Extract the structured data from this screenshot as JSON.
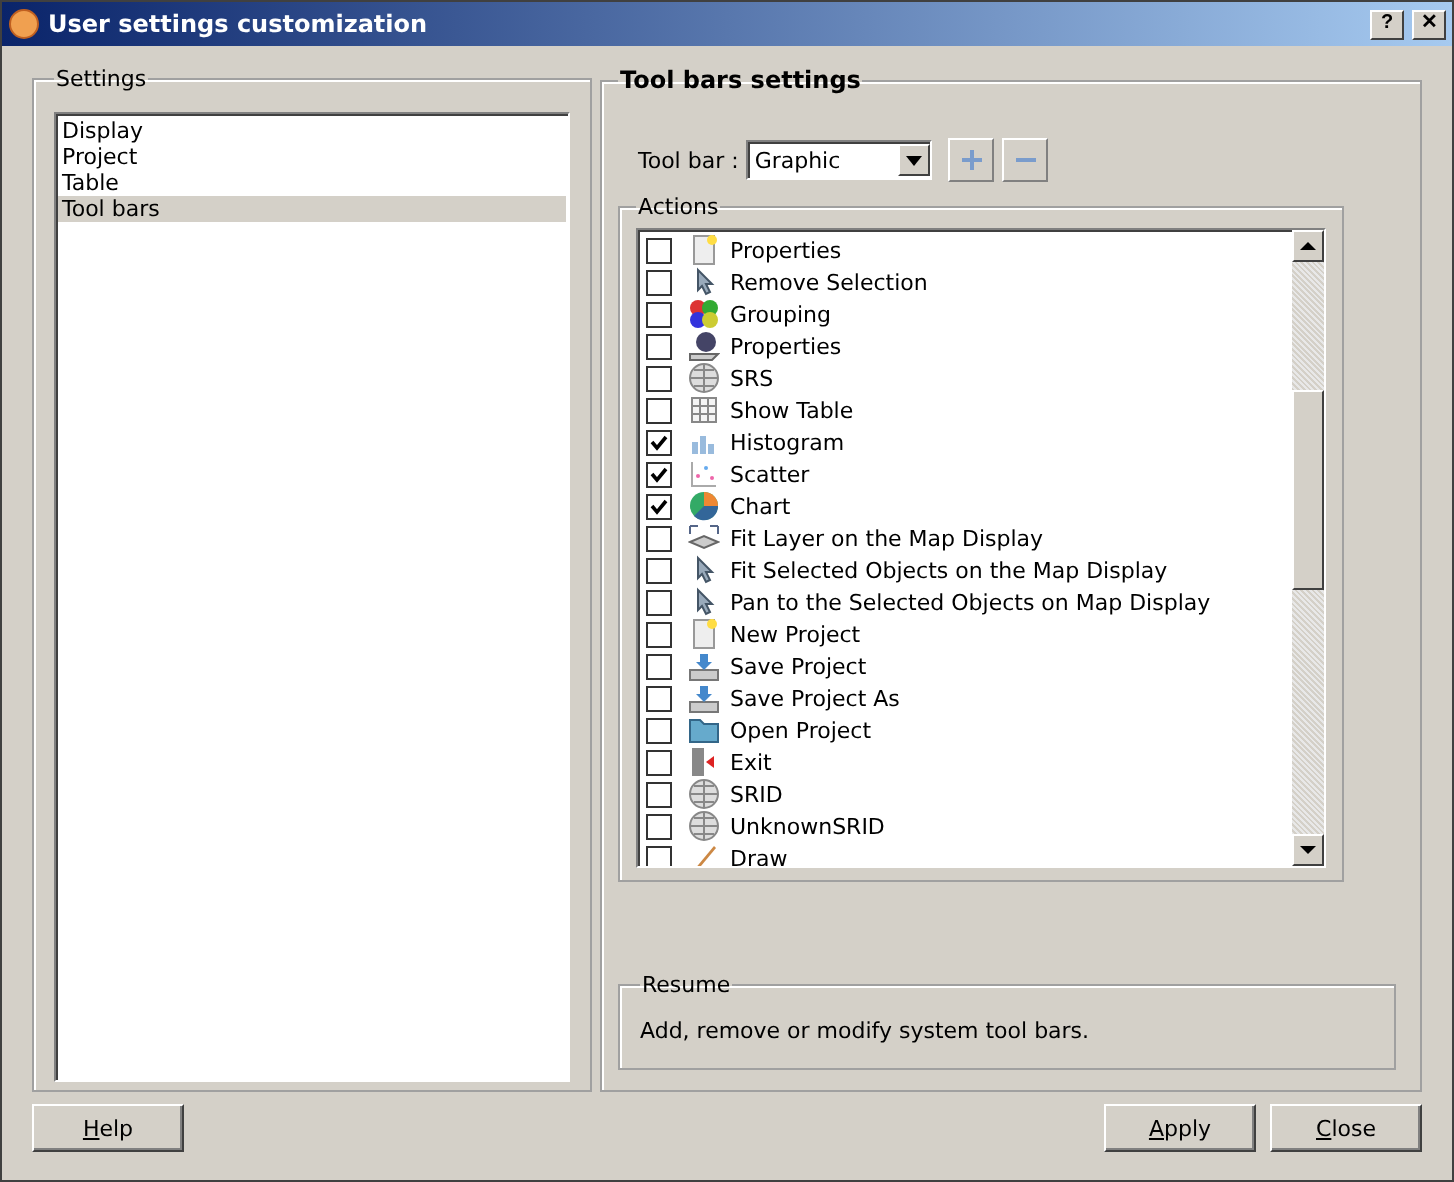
{
  "window": {
    "title": "User settings customization",
    "buttons": [
      "?",
      "✕"
    ]
  },
  "settings": {
    "title": "Settings",
    "items": [
      {
        "label": "Display",
        "selected": false
      },
      {
        "label": "Project",
        "selected": false
      },
      {
        "label": "Table",
        "selected": false
      },
      {
        "label": "Tool bars",
        "selected": true
      }
    ]
  },
  "toolbars": {
    "title": "Tool bars settings",
    "toolbar_label": "Tool bar :",
    "toolbar_value": "Graphic",
    "actions_title": "Actions",
    "actions": [
      {
        "label": "Properties",
        "checked": false
      },
      {
        "label": "Remove Selection",
        "checked": false
      },
      {
        "label": "Grouping",
        "checked": false
      },
      {
        "label": "Properties",
        "checked": false
      },
      {
        "label": "SRS",
        "checked": false
      },
      {
        "label": "Show Table",
        "checked": false
      },
      {
        "label": "Histogram",
        "checked": true
      },
      {
        "label": "Scatter",
        "checked": true
      },
      {
        "label": "Chart",
        "checked": true
      },
      {
        "label": "Fit Layer on the Map Display",
        "checked": false
      },
      {
        "label": "Fit Selected Objects on the Map Display",
        "checked": false
      },
      {
        "label": "Pan to the Selected Objects on Map Display",
        "checked": false
      },
      {
        "label": "New Project",
        "checked": false
      },
      {
        "label": "Save Project",
        "checked": false
      },
      {
        "label": "Save Project As",
        "checked": false
      },
      {
        "label": "Open Project",
        "checked": false
      },
      {
        "label": "Exit",
        "checked": false
      },
      {
        "label": "SRID",
        "checked": false
      },
      {
        "label": "UnknownSRID",
        "checked": false
      },
      {
        "label": "Draw",
        "checked": false
      }
    ],
    "resume_title": "Resume",
    "resume_text": "Add, remove or modify system tool bars."
  },
  "buttons": {
    "left": [
      "Help"
    ],
    "right": [
      "Apply",
      "Close"
    ]
  }
}
